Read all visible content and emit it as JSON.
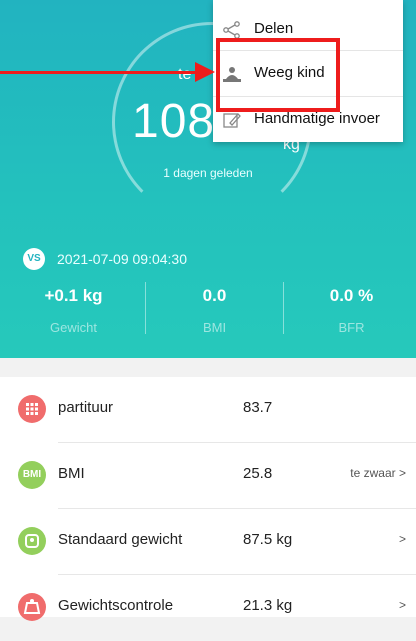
{
  "hero": {
    "weight_label": "te",
    "weight_value": "108",
    "weight_unit": "kg",
    "days_ago": "1 dagen geleden",
    "badge": "VS",
    "datetime": "2021-07-09 09:04:30"
  },
  "metrics": [
    {
      "value": "+0.1 kg",
      "label": "Gewicht"
    },
    {
      "value": "0.0",
      "label": "BMI"
    },
    {
      "value": "0.0 %",
      "label": "BFR"
    }
  ],
  "rows": [
    {
      "name": "partituur",
      "value": "83.7",
      "status": "",
      "icon": "grid-dots-icon",
      "icon_text": "",
      "color": "#f06c6c"
    },
    {
      "name": "BMI",
      "value": "25.8",
      "status": "te zwaar >",
      "icon": "bmi-icon",
      "icon_text": "BMI",
      "color": "#93cf5c"
    },
    {
      "name": "Standaard gewicht",
      "value": "87.5 kg",
      "status": ">",
      "icon": "scale-icon",
      "icon_text": "",
      "color": "#93cf5c"
    },
    {
      "name": "Gewichtscontrole",
      "value": "21.3 kg",
      "status": ">",
      "icon": "weight-control-icon",
      "icon_text": "",
      "color": "#f06c6c"
    }
  ],
  "menu": {
    "share": "Delen",
    "weigh_child": "Weeg kind",
    "manual_input": "Handmatige invoer"
  },
  "annotation_color": "#ee1c1c"
}
